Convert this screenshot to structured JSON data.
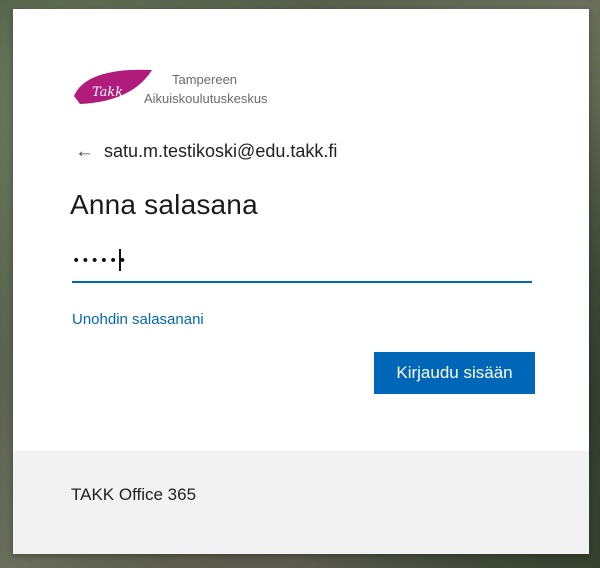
{
  "branding": {
    "logo_mark_text": "Takk",
    "org_name_line1": "Tampereen",
    "org_name_line2": "Aikuiskoulutuskeskus",
    "brand_color": "#b01b7c"
  },
  "identity": {
    "back_icon": "arrow-left-icon",
    "email": "satu.m.testikoski@edu.takk.fi"
  },
  "page": {
    "title": "Anna salasana"
  },
  "password_field": {
    "value_masked": "••••••"
  },
  "links": {
    "forgot_password": "Unohdin salasanani"
  },
  "actions": {
    "sign_in_label": "Kirjaudu sisään",
    "accent_color": "#0067b8"
  },
  "footer": {
    "text": "TAKK Office 365"
  }
}
